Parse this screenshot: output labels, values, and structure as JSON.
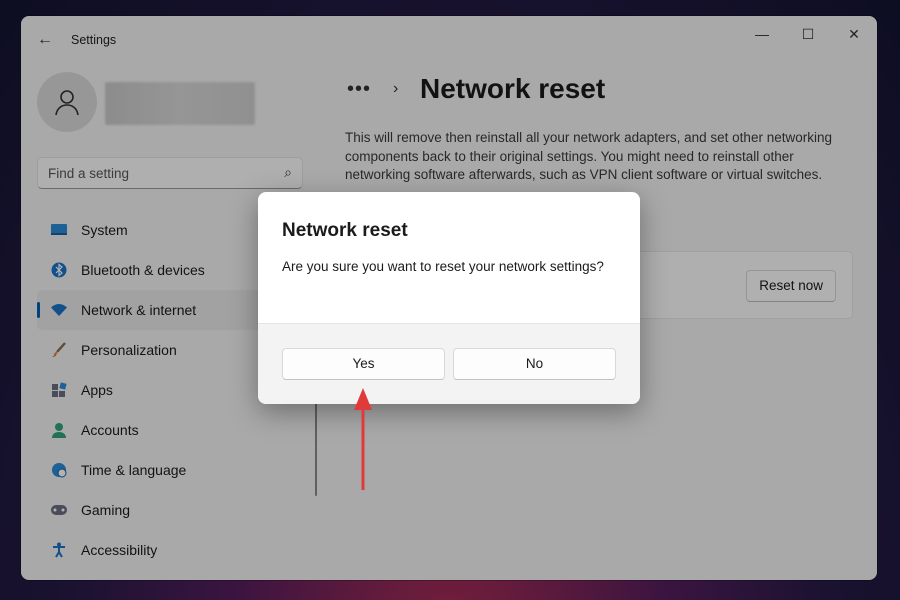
{
  "window": {
    "title": "Settings"
  },
  "search": {
    "placeholder": "Find a setting",
    "icon": "search-icon"
  },
  "sidebar": {
    "items": [
      {
        "label": "System",
        "icon": "system-icon",
        "active": false
      },
      {
        "label": "Bluetooth & devices",
        "icon": "bluetooth-icon",
        "active": false
      },
      {
        "label": "Network & internet",
        "icon": "wifi-icon",
        "active": true
      },
      {
        "label": "Personalization",
        "icon": "brush-icon",
        "active": false
      },
      {
        "label": "Apps",
        "icon": "apps-icon",
        "active": false
      },
      {
        "label": "Accounts",
        "icon": "accounts-icon",
        "active": false
      },
      {
        "label": "Time & language",
        "icon": "globe-clock-icon",
        "active": false
      },
      {
        "label": "Gaming",
        "icon": "gamepad-icon",
        "active": false
      },
      {
        "label": "Accessibility",
        "icon": "accessibility-icon",
        "active": false
      }
    ]
  },
  "breadcrumb": {
    "overflow": "•••",
    "separator": "›"
  },
  "page": {
    "title": "Network reset",
    "description": "This will remove then reinstall all your network adapters, and set other networking components back to their original settings. You might need to reinstall other networking software afterwards, such as VPN client software or virtual switches."
  },
  "card": {
    "button_label": "Reset now"
  },
  "dialog": {
    "title": "Network reset",
    "message": "Are you sure you want to reset your network settings?",
    "yes_label": "Yes",
    "no_label": "No"
  },
  "colors": {
    "accent": "#005fb8",
    "annotation_arrow": "#e03a3a"
  }
}
